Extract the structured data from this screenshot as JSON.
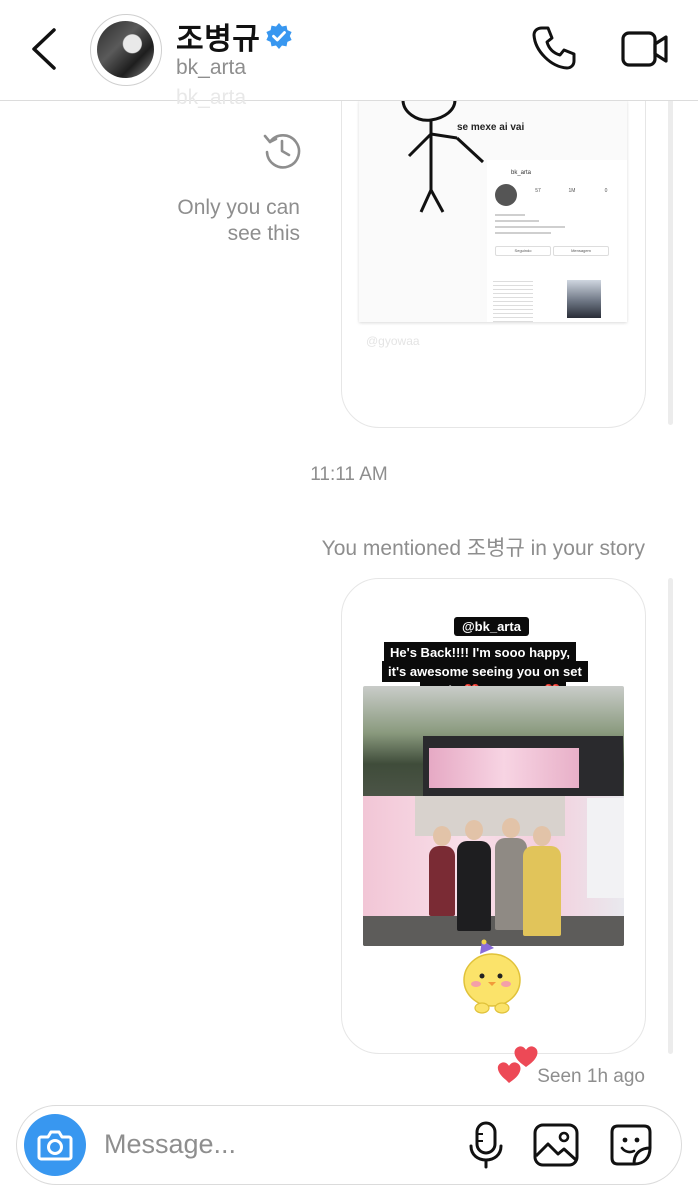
{
  "header": {
    "title": "조병규",
    "subtitle": "bk_arta",
    "subtitle_ghost": "bk_arta",
    "verified_color": "#3897f0",
    "icons": [
      "back-arrow-icon",
      "verified-badge-icon",
      "phone-icon",
      "video-camera-icon"
    ]
  },
  "thread": {
    "story1": {
      "meme_text": "se mexe ai vai",
      "profile_username": "bk_arta",
      "profile_stats": [
        "57",
        "1M",
        "0"
      ],
      "profile_buttons": [
        "Seguindo",
        "Mensagem"
      ],
      "watermark": "@gyowaa"
    },
    "private_note": "Only you can see this",
    "timestamp": "11:11 AM",
    "mention_text": "You mentioned 조병규 in your story",
    "story2": {
      "tag": "@bk_arta",
      "caption_line1": "He's Back!!!! I'm sooo happy,",
      "caption_line2": "it's awesome seeing you on set",
      "caption_line3": "again ❤️ Love you ❤️"
    },
    "seen_status": "Seen 1h ago",
    "heart_color": "#ed4956"
  },
  "composer": {
    "placeholder": "Message...",
    "value": "",
    "camera_button_color": "#3897f0",
    "icons": [
      "camera-icon",
      "microphone-icon",
      "gallery-icon",
      "sticker-icon"
    ]
  }
}
